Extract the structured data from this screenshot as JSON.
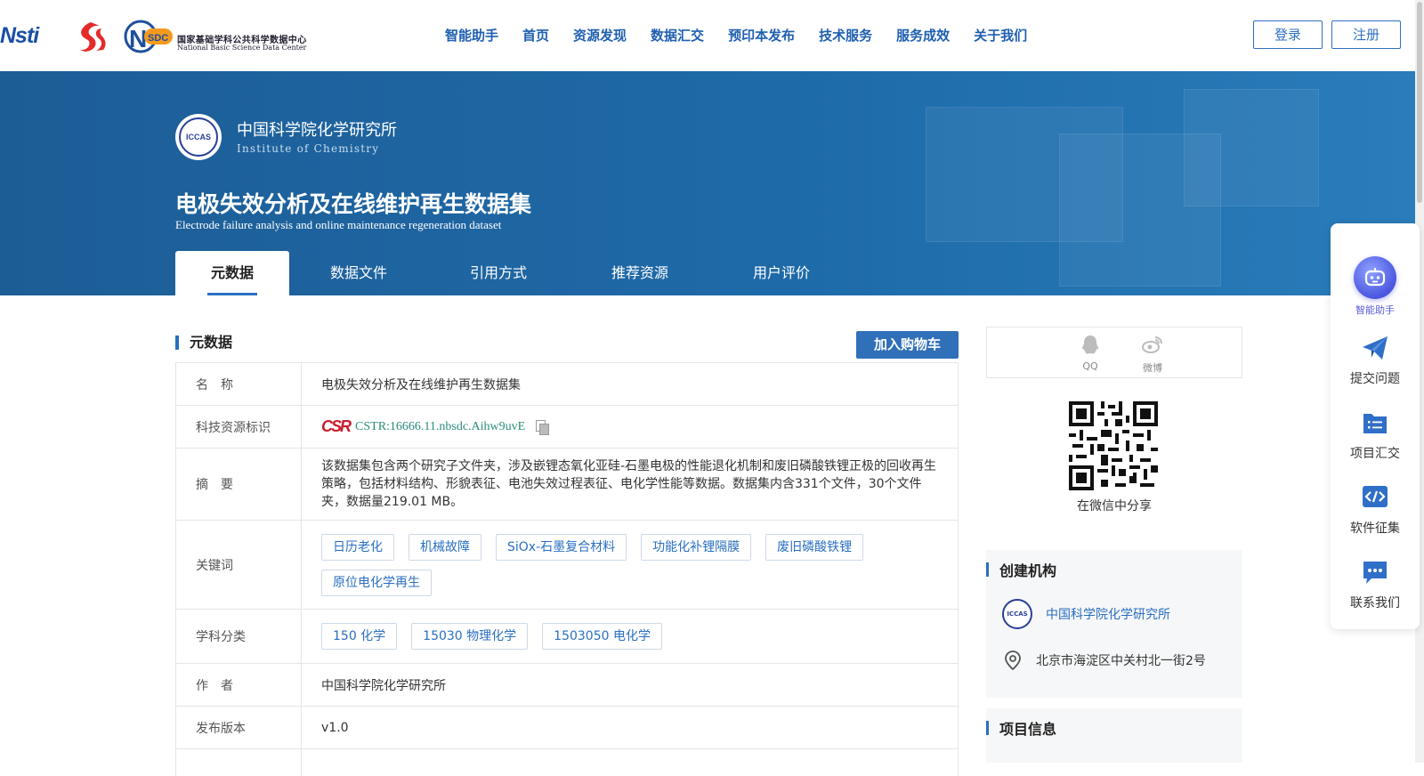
{
  "header": {
    "logos": [
      "cstr-logo",
      "s-logo",
      "nsdc-logo"
    ],
    "cstr_logo_text": "Nsti",
    "nsdc": {
      "abbr": "NSDC",
      "name_zh": "国家基础学科公共科学数据中心",
      "name_en": "National Basic Science Data Center"
    },
    "nav": [
      "智能助手",
      "首页",
      "资源发现",
      "数据汇交",
      "预印本发布",
      "技术服务",
      "服务成效",
      "关于我们"
    ],
    "login_label": "登录",
    "register_label": "注册"
  },
  "banner": {
    "org_logo_text": "ICCAS",
    "org_name": "中国科学院化学研究所",
    "org_name_en": "Institute of Chemistry",
    "title": "电极失效分析及在线维护再生数据集",
    "title_en": "Electrode failure analysis and online maintenance regeneration dataset",
    "tabs": [
      "元数据",
      "数据文件",
      "引用方式",
      "推荐资源",
      "用户评价"
    ],
    "active_tab": 0
  },
  "metadata": {
    "heading": "元数据",
    "cart_label": "加入购物车",
    "rows": {
      "name": {
        "label": "名　称",
        "value": "电极失效分析及在线维护再生数据集"
      },
      "cstr": {
        "label": "科技资源标识",
        "logo": "CSR",
        "value": "CSTR:16666.11.nbsdc.Aihw9uvE"
      },
      "abstract": {
        "label": "摘　要",
        "value": "该数据集包含两个研究子文件夹，涉及嵌锂态氧化亚硅-石墨电极的性能退化机制和废旧磷酸铁锂正极的回收再生策略，包括材料结构、形貌表征、电池失效过程表征、电化学性能等数据。数据集内含331个文件，30个文件夹，数据量219.01 MB。"
      },
      "keywords": {
        "label": "关键词",
        "items": [
          "日历老化",
          "机械故障",
          "SiOx-石墨复合材料",
          "功能化补锂隔膜",
          "废旧磷酸铁锂",
          "原位电化学再生"
        ]
      },
      "subjects": {
        "label": "学科分类",
        "items": [
          "150 化学",
          "15030 物理化学",
          "1503050 电化学"
        ]
      },
      "author": {
        "label": "作　者",
        "value": "中国科学院化学研究所"
      },
      "version": {
        "label": "发布版本",
        "value": "v1.0"
      }
    }
  },
  "share": {
    "items": [
      {
        "label": "QQ",
        "icon": "qq-icon"
      },
      {
        "label": "微博",
        "icon": "weibo-icon"
      }
    ],
    "qr_caption": "在微信中分享"
  },
  "org_panel": {
    "heading": "创建机构",
    "logo_text": "ICCAS",
    "org_link": "中国科学院化学研究所",
    "address": "北京市海淀区中关村北一街2号"
  },
  "project_panel": {
    "heading": "项目信息"
  },
  "float_tools": {
    "items": [
      {
        "label": "智能助手",
        "icon": "robot-icon"
      },
      {
        "label": "提交问题",
        "icon": "paper-plane-icon"
      },
      {
        "label": "项目汇交",
        "icon": "folder-list-icon"
      },
      {
        "label": "软件征集",
        "icon": "code-icon"
      },
      {
        "label": "联系我们",
        "icon": "chat-icon"
      }
    ]
  },
  "colors": {
    "primary": "#2a6fc0",
    "banner": "#1e64a3",
    "nav_text": "#1f5fb0",
    "cstr_link": "#2a8c7a"
  }
}
